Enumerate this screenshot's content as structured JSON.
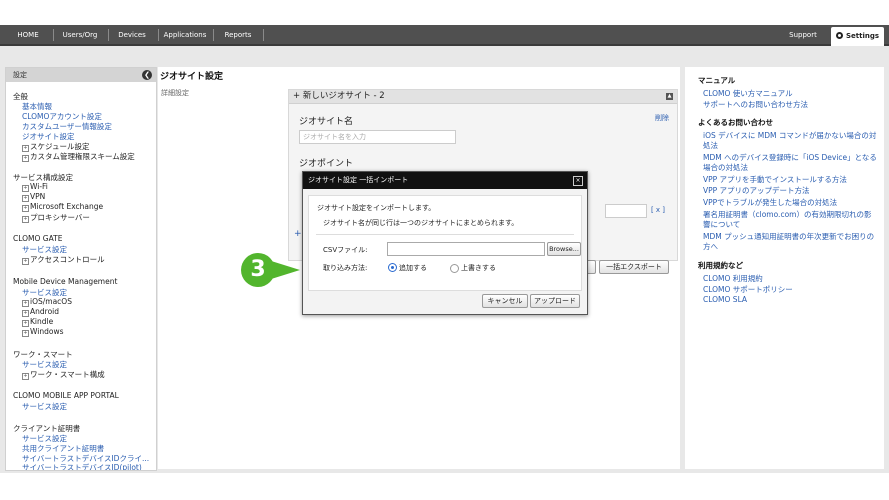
{
  "topnav": {
    "tabs": [
      "HOME",
      "Users/Org",
      "Devices",
      "Applications",
      "Reports"
    ],
    "support": "Support",
    "settings": "Settings"
  },
  "sidebar": {
    "header": "設定",
    "sections": [
      {
        "title": "全般",
        "items": [
          {
            "label": "基本情報",
            "type": "link"
          },
          {
            "label": "CLOMOアカウント設定",
            "type": "link"
          },
          {
            "label": "カスタムユーザー情報設定",
            "type": "link"
          },
          {
            "label": "ジオサイト設定",
            "type": "link"
          },
          {
            "label": "スケジュール設定",
            "type": "expand"
          },
          {
            "label": "カスタム管理権限スキーム設定",
            "type": "expand"
          }
        ]
      },
      {
        "title": "サービス構成設定",
        "items": [
          {
            "label": "Wi-Fi",
            "type": "expand"
          },
          {
            "label": "VPN",
            "type": "expand"
          },
          {
            "label": "Microsoft Exchange",
            "type": "expand"
          },
          {
            "label": "プロキシサーバー",
            "type": "expand"
          }
        ]
      },
      {
        "title": "CLOMO GATE",
        "items": [
          {
            "label": "サービス設定",
            "type": "link"
          },
          {
            "label": "アクセスコントロール",
            "type": "expand"
          }
        ]
      },
      {
        "title": "Mobile Device Management",
        "items": [
          {
            "label": "サービス設定",
            "type": "link"
          },
          {
            "label": "iOS/macOS",
            "type": "expand"
          },
          {
            "label": "Android",
            "type": "expand"
          },
          {
            "label": "Kindle",
            "type": "expand"
          },
          {
            "label": "Windows",
            "type": "expand"
          }
        ]
      },
      {
        "title": "ワーク・スマート",
        "items": [
          {
            "label": "サービス設定",
            "type": "link"
          },
          {
            "label": "ワーク・スマート構成",
            "type": "expand"
          }
        ]
      },
      {
        "title": "CLOMO MOBILE APP PORTAL",
        "items": [
          {
            "label": "サービス設定",
            "type": "link"
          }
        ]
      },
      {
        "title": "クライアント証明書",
        "items": [
          {
            "label": "サービス設定",
            "type": "link"
          },
          {
            "label": "共用クライアント証明書",
            "type": "link"
          },
          {
            "label": "サイバートラストデバイスIDクライ...",
            "type": "link"
          },
          {
            "label": "サイバートラストデバイスID(pilot)",
            "type": "link"
          }
        ]
      }
    ]
  },
  "main": {
    "title": "ジオサイト設定",
    "detail_label": "詳細設定",
    "panel_title": "+ 新しいジオサイト - 2",
    "delete": "削除",
    "site_name_label": "ジオサイト名",
    "site_name_placeholder": "ジオサイト名を入力",
    "geopoint_label": "ジオポイント",
    "remove_point": "[ x ]",
    "add_plus": "+",
    "export_button": "一括エクスポート"
  },
  "modal": {
    "title": "ジオサイト設定 一括インポート",
    "close": "×",
    "line1": "ジオサイト設定をインポートします。",
    "line2": "ジオサイト名が同じ行は一つのジオサイトにまとめられます。",
    "csv_label": "CSVファイル:",
    "browse": "Browse...",
    "method_label": "取り込み方法:",
    "option_add": "追加する",
    "option_overwrite": "上書きする",
    "selected_option": "追加する",
    "cancel": "キャンセル",
    "upload": "アップロード"
  },
  "step": {
    "number": "3",
    "color": "#52b52d"
  },
  "right": {
    "manual_heading": "マニュアル",
    "manual_links": [
      "CLOMO 使い方マニュアル",
      "サポートへのお問い合わせ方法"
    ],
    "faq_heading": "よくあるお問い合わせ",
    "faq_links": [
      [
        "iOS デバイスに MDM コマンドが届かない場合の対",
        "処法"
      ],
      [
        "MDM へのデバイス登録時に「iOS Device」となる",
        "場合の対処法"
      ],
      [
        "VPP アプリを手動でインストールする方法"
      ],
      [
        "VPP アプリのアップデート方法"
      ],
      [
        "VPPでトラブルが発生した場合の対処法"
      ],
      [
        "署名用証明書（clomo.com）の有効期限切れの影",
        "響について"
      ],
      [
        "MDM プッシュ通知用証明書の年次更新でお困りの",
        "方へ"
      ]
    ],
    "terms_heading": "利用規約など",
    "terms_links": [
      "CLOMO 利用規約",
      "CLOMO サポートポリシー",
      "CLOMO SLA"
    ]
  }
}
